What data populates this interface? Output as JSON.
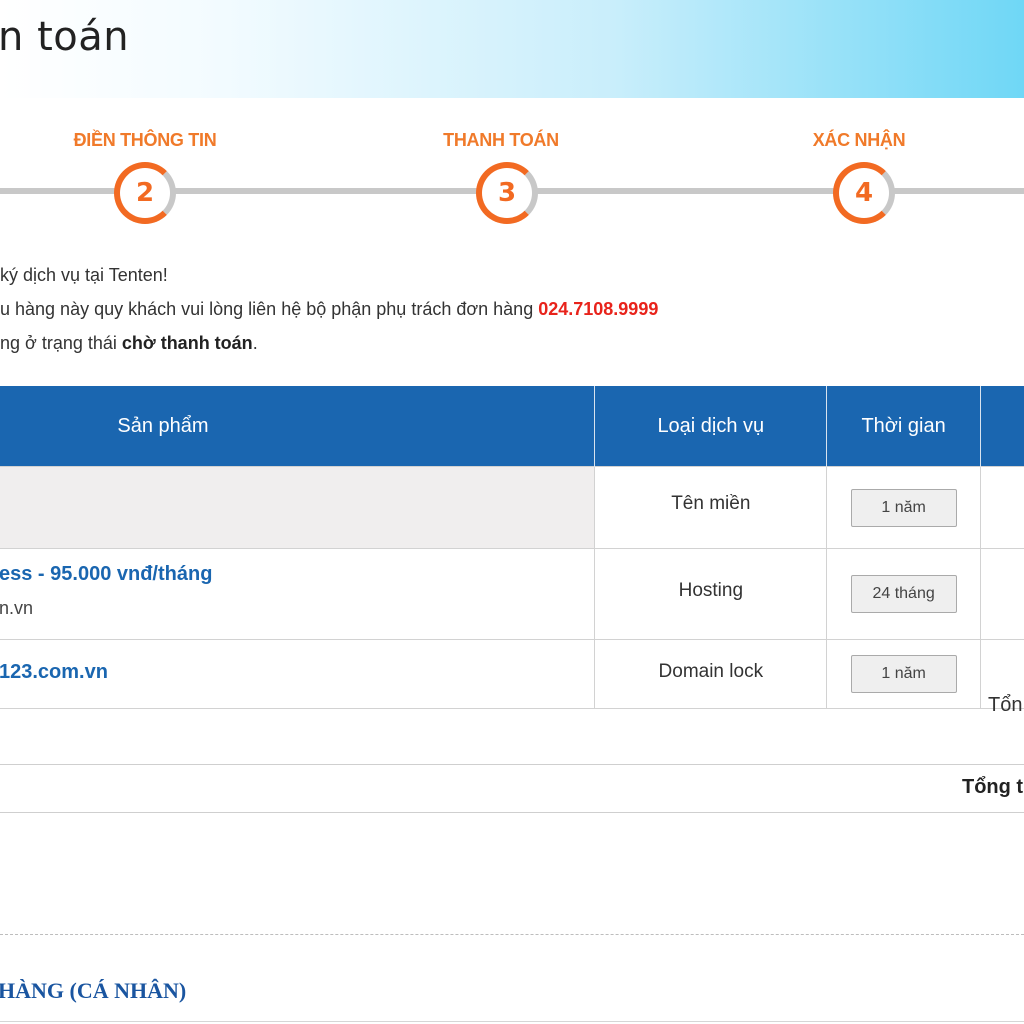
{
  "header": {
    "title": "n toán"
  },
  "steps": [
    {
      "label": "ĐIỀN THÔNG TIN",
      "number": "2"
    },
    {
      "label": "THANH TOÁN",
      "number": "3"
    },
    {
      "label": "XÁC NHẬN",
      "number": "4"
    }
  ],
  "message": {
    "line1": "ký dịch vụ tại Tenten!",
    "line2_text": "u hàng này quy khách vui lòng liên hệ bộ phận phụ trách đơn hàng ",
    "line2_phone": "024.7108.9999",
    "line3_text": "ng ở trạng thái ",
    "line3_bold": "chờ thanh toán",
    "line3_end": "."
  },
  "table": {
    "headers": {
      "product": "Sản phẩm",
      "service_type": "Loại dịch vụ",
      "duration": "Thời gian"
    },
    "rows": [
      {
        "product_name": "",
        "product_sub": "",
        "service_type": "Tên miền",
        "duration": "1 năm"
      },
      {
        "product_name": "ess - 95.000 vnđ/tháng",
        "product_sub": "n.vn",
        "service_type": "Hosting",
        "duration": "24 tháng"
      },
      {
        "product_name": "123.com.vn",
        "product_sub": "",
        "service_type": "Domain lock",
        "duration": "1 năm"
      }
    ]
  },
  "totals": {
    "subtotal_label": "Tổn",
    "total_label": "Tổng t"
  },
  "customer_section": {
    "title": "HÀNG (CÁ NHÂN)"
  },
  "colors": {
    "accent_blue": "#1a66b0",
    "step_orange": "#f26a22",
    "phone_red": "#e8231b"
  }
}
